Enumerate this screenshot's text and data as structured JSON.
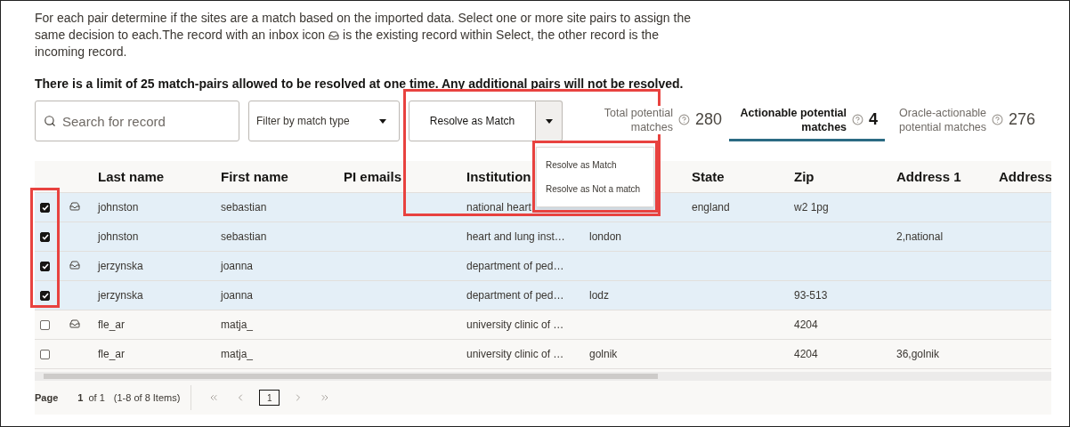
{
  "intro": [
    [
      "For each pair determine if the sites are a match based on the imported data. Select one or more site pairs to assign the"
    ],
    [
      "same decision to each.The record with an inbox icon",
      "is the existing record within Select, the other record is the"
    ],
    [
      "incoming record."
    ]
  ],
  "warning": "There is a limit of 25 match-pairs allowed to be resolved at one time. Any additional pairs will not be resolved.",
  "search": {
    "placeholder": "Search for record"
  },
  "filter": {
    "placeholder": "Filter by match type"
  },
  "resolve_button": {
    "label": "Resolve as Match",
    "menu_open": true
  },
  "resolve_menu": [
    "Resolve as Match",
    "Resolve as Not a match"
  ],
  "tabs": [
    {
      "label": "Total potential matches",
      "count": "280",
      "selected": false
    },
    {
      "label": "Actionable potential matches",
      "count": "4",
      "selected": true
    },
    {
      "label": "Oracle-actionable potential matches",
      "count": "276",
      "selected": false
    }
  ],
  "table": {
    "columns": [
      "Last name",
      "First name",
      "PI emails",
      "Institution",
      null,
      "State",
      "Zip",
      "Address 1",
      "Address"
    ],
    "rows": [
      {
        "checked": true,
        "existing": true,
        "cells": [
          "johnston",
          "sebastian",
          null,
          "national heart",
          null,
          "england",
          "w2 1pg",
          null,
          null
        ]
      },
      {
        "checked": true,
        "existing": false,
        "cells": [
          "johnston",
          "sebastian",
          null,
          "heart and lung inst…",
          "london",
          null,
          null,
          "2,national",
          null
        ]
      },
      {
        "checked": true,
        "existing": true,
        "cells": [
          "jerzynska",
          "joanna",
          null,
          "department of ped…",
          null,
          null,
          null,
          null,
          null
        ]
      },
      {
        "checked": true,
        "existing": false,
        "cells": [
          "jerzynska",
          "joanna",
          null,
          "department of ped…",
          "lodz",
          null,
          "93-513",
          null,
          null
        ]
      },
      {
        "checked": false,
        "existing": true,
        "cells": [
          "fle_ar",
          "matja_",
          null,
          "university clinic of …",
          null,
          null,
          "4204",
          null,
          null
        ]
      },
      {
        "checked": false,
        "existing": false,
        "cells": [
          "fle_ar",
          "matja_",
          null,
          "university clinic of …",
          "golnik",
          null,
          "4204",
          "36,golnik",
          null
        ]
      }
    ]
  },
  "pagination": {
    "label": "Page",
    "page": "1",
    "of": "of 1",
    "range": "(1-8 of 8 Items)",
    "page_input": "1"
  }
}
